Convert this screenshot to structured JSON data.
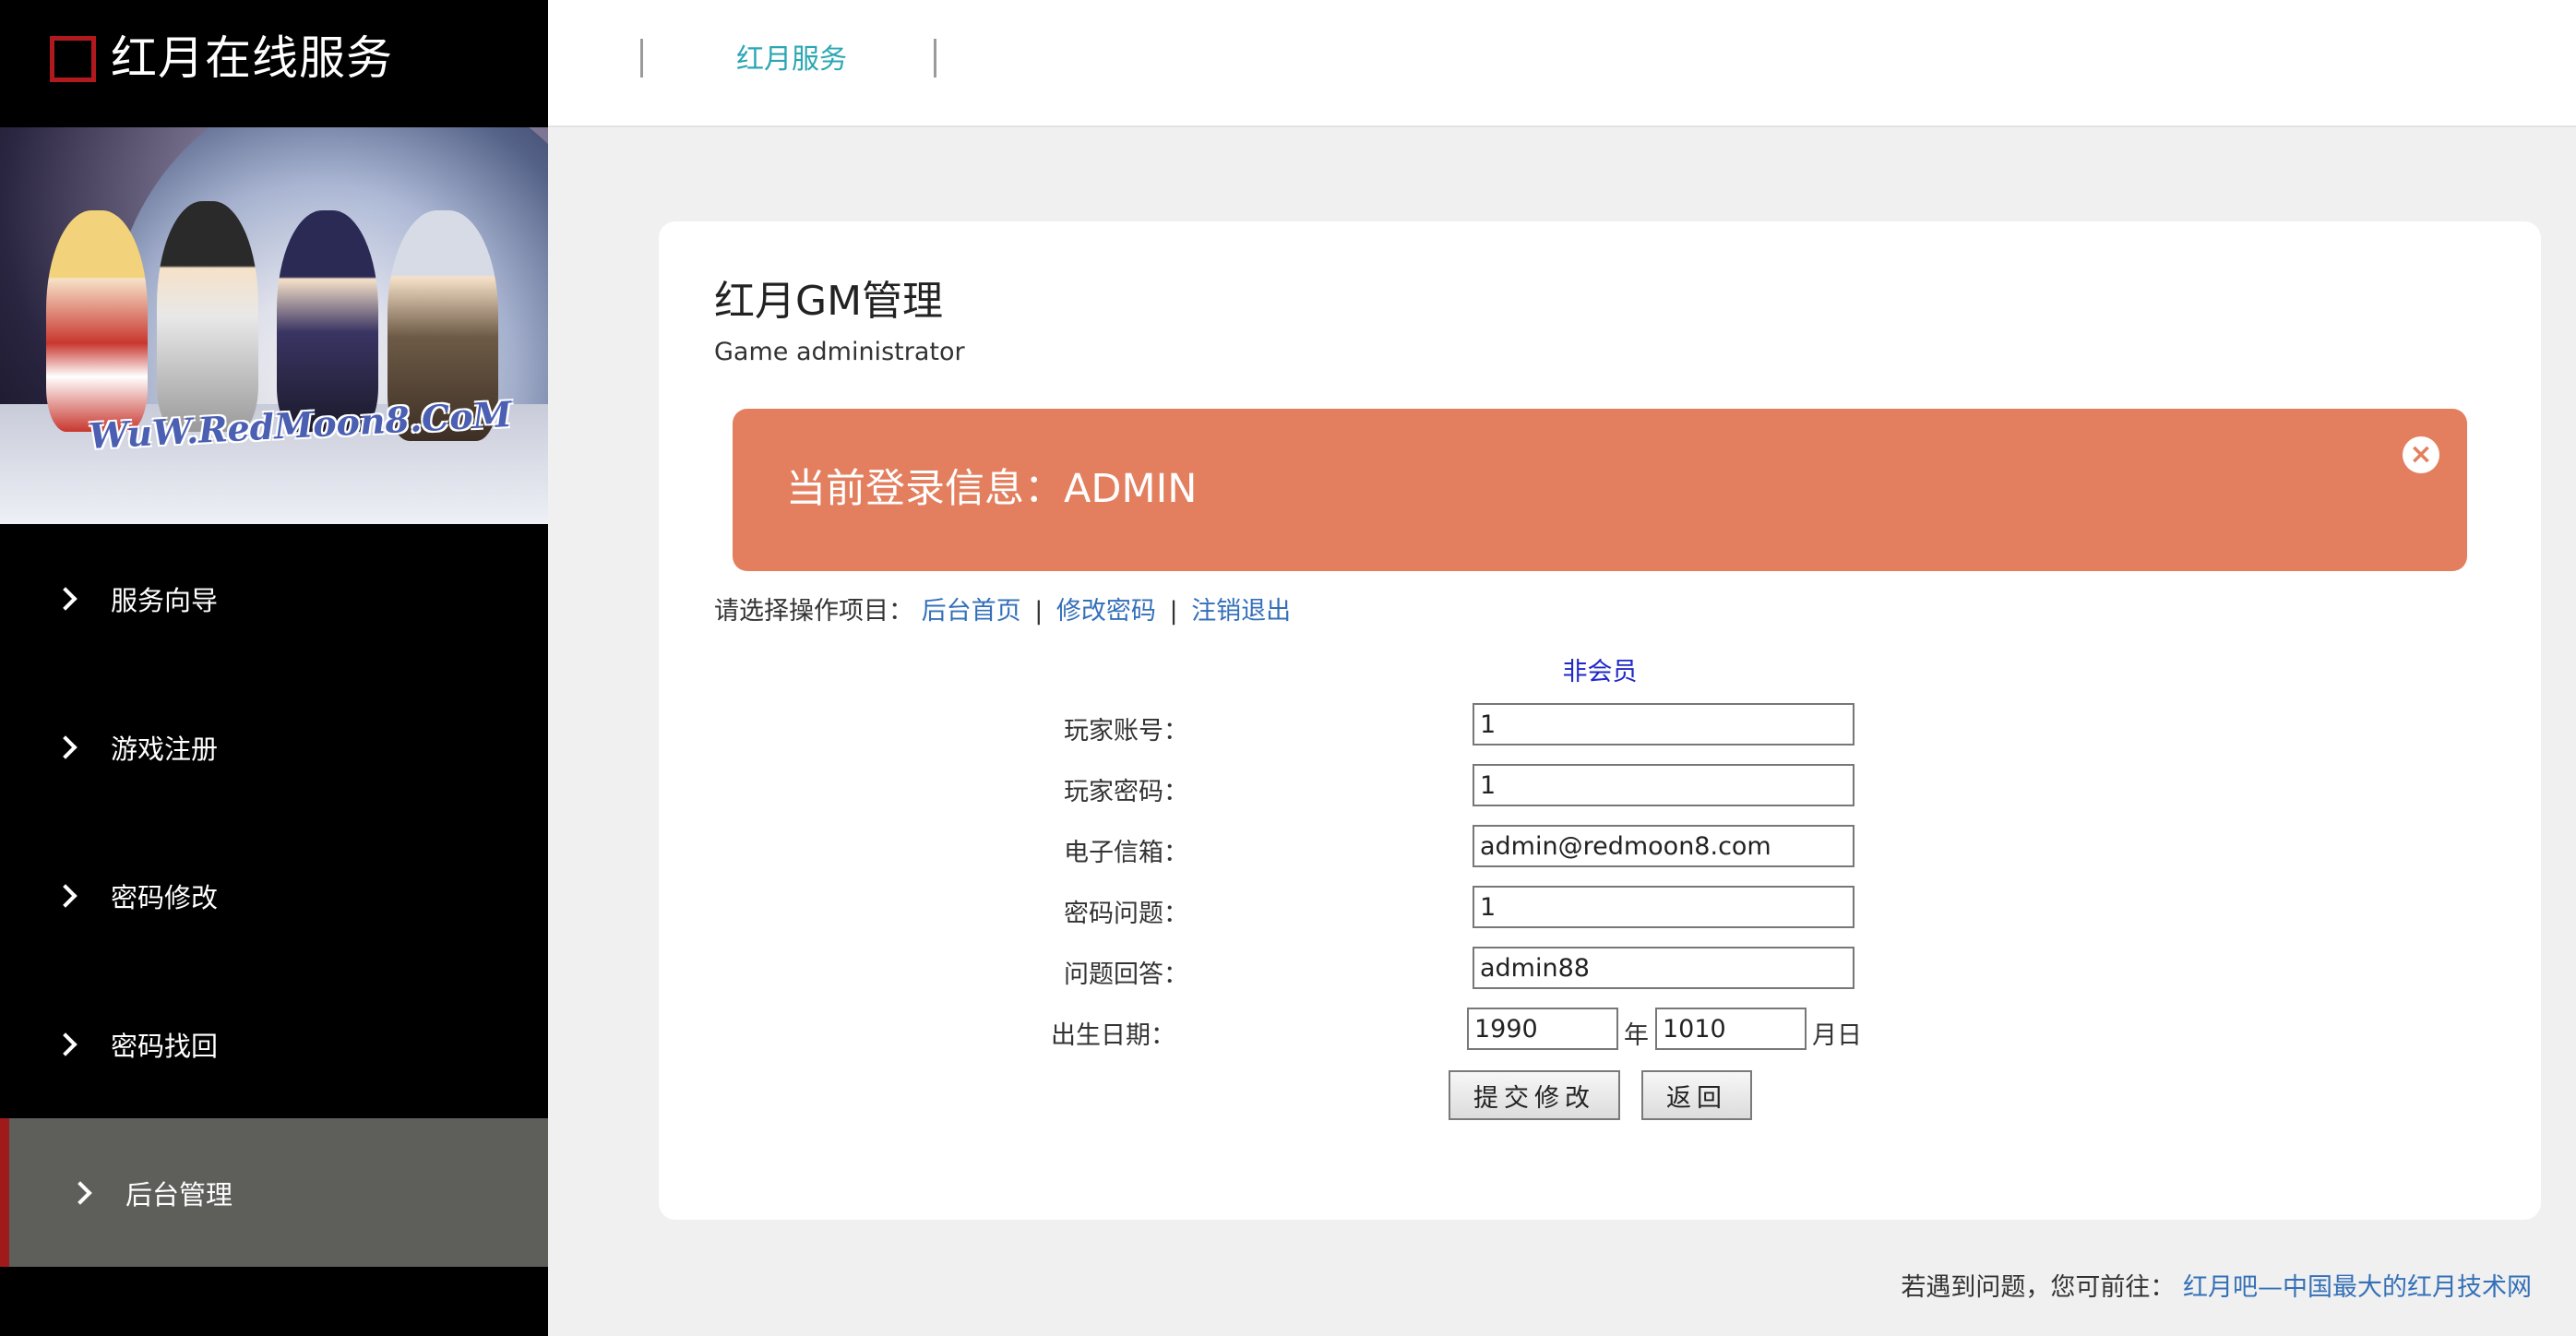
{
  "sidebar": {
    "brand_title": "红月在线服务",
    "banner_watermark": "WuW.RedMoon8.CoM",
    "items": [
      {
        "label": "服务向导"
      },
      {
        "label": "游戏注册"
      },
      {
        "label": "密码修改"
      },
      {
        "label": "密码找回"
      },
      {
        "label": "后台管理"
      }
    ]
  },
  "header": {
    "tab_label": "红月服务"
  },
  "main": {
    "title": "红月GM管理",
    "subtitle": "Game administrator",
    "alert": {
      "text": "当前登录信息：ADMIN",
      "close_symbol": "×",
      "color": "#e37f5e"
    },
    "ops": {
      "prompt": "请选择操作项目：",
      "links": [
        "后台首页",
        "修改密码",
        "注销退出"
      ],
      "separator": "|"
    },
    "membership": "非会员",
    "form": {
      "account": {
        "label": "玩家账号：",
        "value": "1"
      },
      "password": {
        "label": "玩家密码：",
        "value": "1"
      },
      "email": {
        "label": "电子信箱：",
        "value": "admin@redmoon8.com"
      },
      "question": {
        "label": "密码问题：",
        "value": "1"
      },
      "answer": {
        "label": "问题回答：",
        "value": "admin88"
      },
      "birth": {
        "label": "出生日期：",
        "year_value": "1990",
        "year_unit": "年",
        "monthday_value": "1010",
        "monthday_unit": "月日"
      },
      "submit_label": "提交修改",
      "back_label": "返回"
    }
  },
  "footer": {
    "prompt": "若遇到问题，您可前往：",
    "link_label": "红月吧—中国最大的红月技术网"
  },
  "colors": {
    "sidebar_bg": "#000000",
    "active_item_bg": "#5e5e5b",
    "active_item_accent": "#9f1b1b",
    "tab_color": "#2aa7b3",
    "link_color": "#3470b8",
    "member_color": "#2028c7"
  }
}
